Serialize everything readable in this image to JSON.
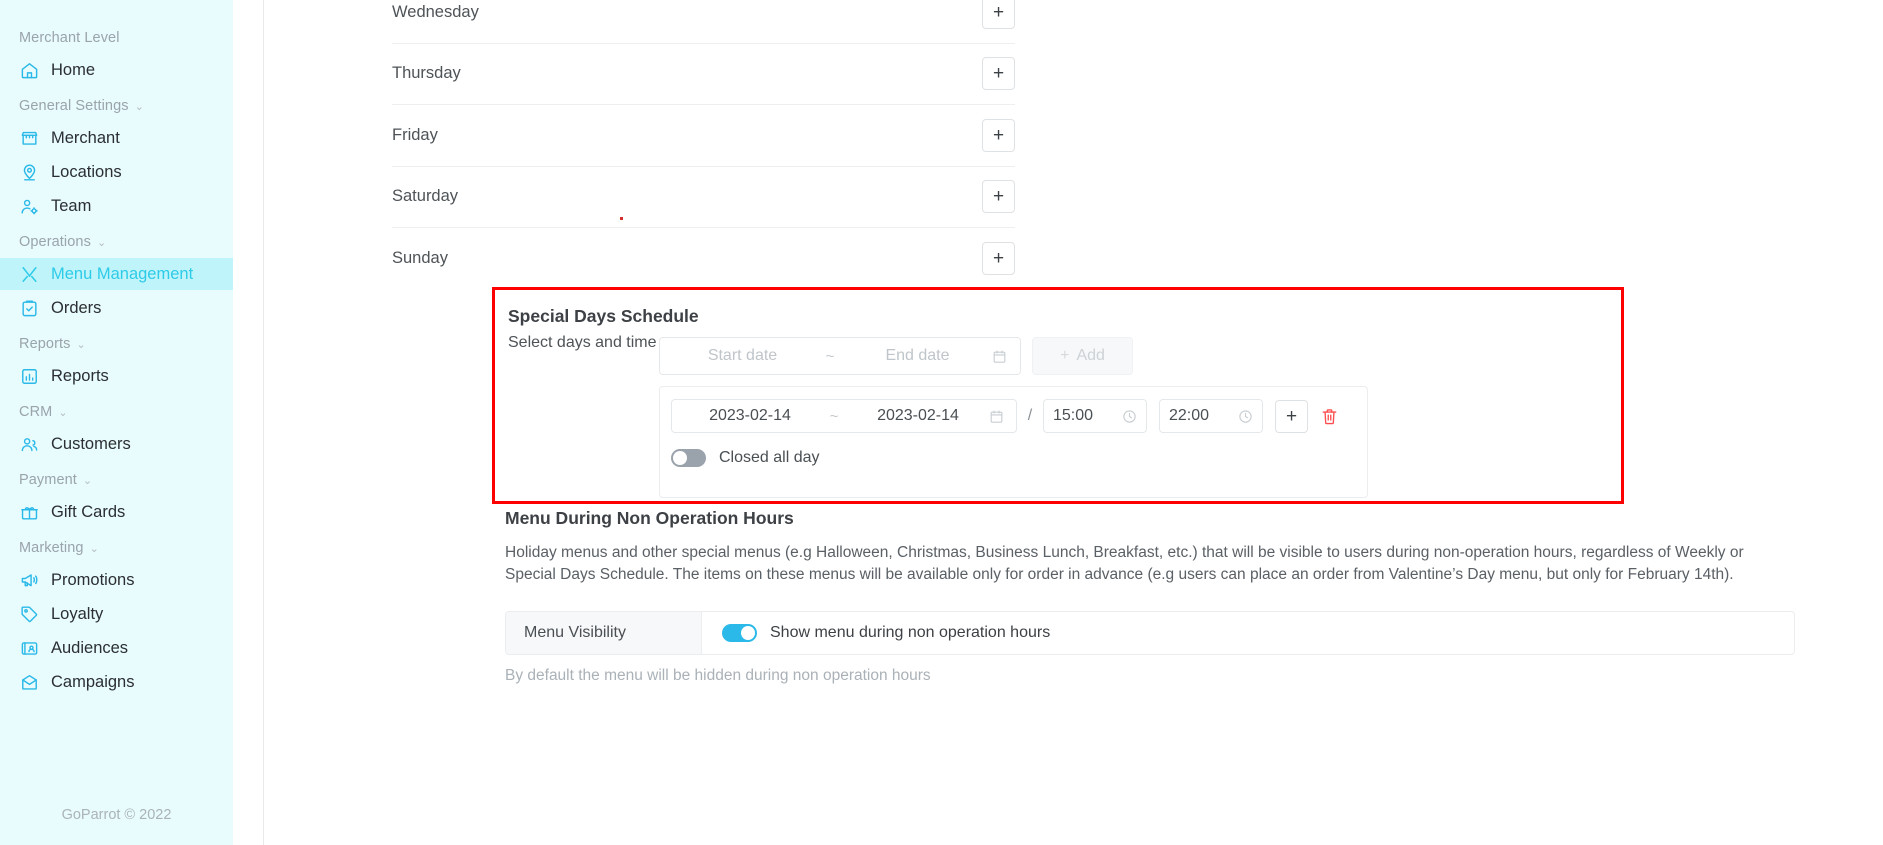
{
  "sidebar": {
    "groups": [
      {
        "header": "Merchant Level",
        "collapsible": false,
        "items": [
          {
            "label": "Home",
            "icon": "home-icon",
            "active": false
          }
        ]
      },
      {
        "header": "General Settings",
        "collapsible": true,
        "items": [
          {
            "label": "Merchant",
            "icon": "store-icon",
            "active": false
          },
          {
            "label": "Locations",
            "icon": "map-pin-icon",
            "active": false
          },
          {
            "label": "Team",
            "icon": "user-gear-icon",
            "active": false
          }
        ]
      },
      {
        "header": "Operations",
        "collapsible": true,
        "items": [
          {
            "label": "Menu Management",
            "icon": "cutlery-icon",
            "active": true
          },
          {
            "label": "Orders",
            "icon": "clipboard-check-icon",
            "active": false
          }
        ]
      },
      {
        "header": "Reports",
        "collapsible": true,
        "items": [
          {
            "label": "Reports",
            "icon": "bar-chart-icon",
            "active": false
          }
        ]
      },
      {
        "header": "CRM",
        "collapsible": true,
        "items": [
          {
            "label": "Customers",
            "icon": "users-icon",
            "active": false
          }
        ]
      },
      {
        "header": "Payment",
        "collapsible": true,
        "items": [
          {
            "label": "Gift Cards",
            "icon": "gift-icon",
            "active": false
          }
        ]
      },
      {
        "header": "Marketing",
        "collapsible": true,
        "items": [
          {
            "label": "Promotions",
            "icon": "megaphone-icon",
            "active": false
          },
          {
            "label": "Loyalty",
            "icon": "tag-icon",
            "active": false
          },
          {
            "label": "Audiences",
            "icon": "audience-card-icon",
            "active": false
          },
          {
            "label": "Campaigns",
            "icon": "envelope-icon",
            "active": false
          }
        ]
      }
    ],
    "footer": "GoParrot © 2022",
    "chevron": "⌄"
  },
  "weekly_schedule": {
    "days": [
      {
        "name": "Wednesday",
        "add_label": "+"
      },
      {
        "name": "Thursday",
        "add_label": "+"
      },
      {
        "name": "Friday",
        "add_label": "+"
      },
      {
        "name": "Saturday",
        "add_label": "+"
      },
      {
        "name": "Sunday",
        "add_label": "+"
      }
    ]
  },
  "special_days": {
    "title": "Special Days Schedule",
    "select_label": "Select days and time",
    "range_picker": {
      "start_placeholder": "Start date",
      "separator": "~",
      "end_placeholder": "End date"
    },
    "add_button": {
      "plus": "+",
      "label": "Add"
    },
    "entry": {
      "start_date": "2023-02-14",
      "separator": "~",
      "end_date": "2023-02-14",
      "slash": "/",
      "start_time": "15:00",
      "end_time": "22:00",
      "add_time_label": "+",
      "closed_all_day_label": "Closed all day",
      "closed_all_day_on": false
    },
    "highlight_color": "#ff0000"
  },
  "non_operation": {
    "title": "Menu During Non Operation Hours",
    "description": "Holiday menus and other special menus (e.g Halloween, Christmas, Business Lunch, Breakfast, etc.) that will be visible to users during non-operation hours, regardless of Weekly or Special Days Schedule. The items on these menus will be available only for order in advance (e.g users can place an order from Valentine’s Day menu, but only for February 14th).",
    "visibility_label": "Menu Visibility",
    "visibility_toggle_text": "Show menu during non operation hours",
    "visibility_on": true,
    "hint": "By default the menu will be hidden during non operation hours",
    "accent_color": "#2ab9e8"
  }
}
